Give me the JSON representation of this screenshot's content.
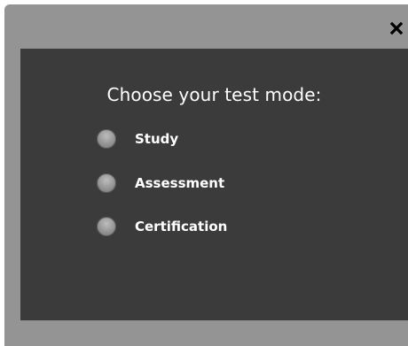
{
  "dialog": {
    "close_icon": "close-icon",
    "heading": "Choose your test mode:",
    "options": [
      {
        "label": "Study",
        "icon": "radio-button-icon"
      },
      {
        "label": "Assessment",
        "icon": "radio-button-icon"
      },
      {
        "label": "Certification",
        "icon": "radio-button-icon"
      }
    ]
  },
  "colors": {
    "frame": "#949494",
    "panel": "#3b3b3b",
    "text": "#ffffff"
  }
}
